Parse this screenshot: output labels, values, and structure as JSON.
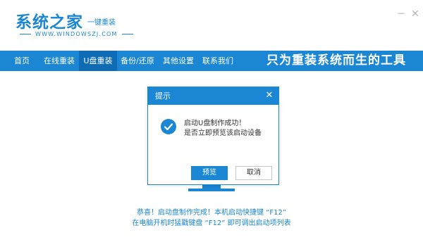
{
  "app": {
    "logo": "系统之家",
    "logo_sub": "一键重装",
    "logo_url": "WWW.WINDOWSZJ.COM"
  },
  "window_controls": {
    "minimize": "─",
    "close": "✕"
  },
  "nav": {
    "items": [
      {
        "label": "首页"
      },
      {
        "label": "在线重装"
      },
      {
        "label": "U盘重装"
      },
      {
        "label": "备份/还原"
      },
      {
        "label": "其他设置"
      },
      {
        "label": "联系我们"
      }
    ],
    "active_index": 2,
    "slogan": "只为重装系统而生的工具"
  },
  "dialog": {
    "title": "提示",
    "close": "✕",
    "message_line1": "启动U盘制作成功！",
    "message_line2": "是否立即预览该启动设备",
    "ok_label": "预览",
    "cancel_label": "取消",
    "icon": "check-circle-icon"
  },
  "footer": {
    "tip_line1": "恭喜！启动盘制作完成！本机启动快捷键 “F12”",
    "tip_line2": "在电脑开机时猛戳键盘 “F12” 即可调出启动项列表"
  },
  "colors": {
    "accent": "#1a86d4",
    "accent_dark": "#0e6cb6",
    "background": "#ffffff"
  }
}
